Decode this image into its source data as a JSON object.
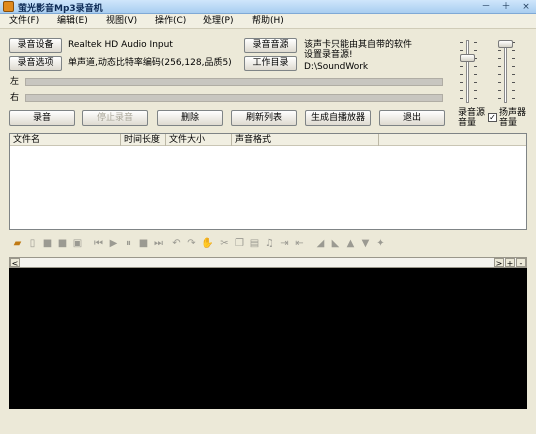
{
  "window": {
    "title": "萤光影音Mp3录音机",
    "minimize": "－",
    "maximize": "＋",
    "close": "×"
  },
  "menu": [
    "文件(F)",
    "编辑(E)",
    "视图(V)",
    "操作(C)",
    "处理(P)",
    "帮助(H)"
  ],
  "record_device": {
    "button": "录音设备",
    "value": "Realtek HD Audio Input"
  },
  "record_options": {
    "button": "录音选项",
    "value": "单声道,动态比特率编码(256,128,品质5)"
  },
  "record_source": {
    "button": "录音音源",
    "note": "该声卡只能由其自带的软件设置录音源!"
  },
  "work_dir": {
    "button": "工作目录",
    "value": "D:\\SoundWork"
  },
  "levels": {
    "left": "左",
    "right": "右"
  },
  "actions": {
    "record": "录音",
    "stop": "停止录音",
    "delete": "删除",
    "refresh": "刷新列表",
    "autoplay": "生成自播放器",
    "exit": "退出"
  },
  "volume": {
    "source_label": "录音源音量",
    "speaker_label": "扬声器音量",
    "speaker_checked": "✓"
  },
  "file_list": {
    "columns": [
      "文件名",
      "时间长度",
      "文件大小",
      "声音格式"
    ]
  },
  "toolbar": {
    "icons": [
      "open-icon",
      "new-icon",
      "save-icon",
      "save-as-icon",
      "export-icon",
      "skip-start-icon",
      "play-icon",
      "pause-icon",
      "stop-icon",
      "skip-end-icon",
      "undo-icon",
      "redo-icon",
      "hand-icon",
      "cut-icon",
      "copy-icon",
      "paste-icon",
      "mix-icon",
      "trim-icon",
      "insert-icon",
      "fade-in-icon",
      "fade-out-icon",
      "volume-up-icon",
      "volume-down-icon",
      "effect-icon"
    ]
  },
  "scroll": {
    "left": "<",
    "right": ">",
    "zoom_in": "+",
    "zoom_out": "-"
  }
}
